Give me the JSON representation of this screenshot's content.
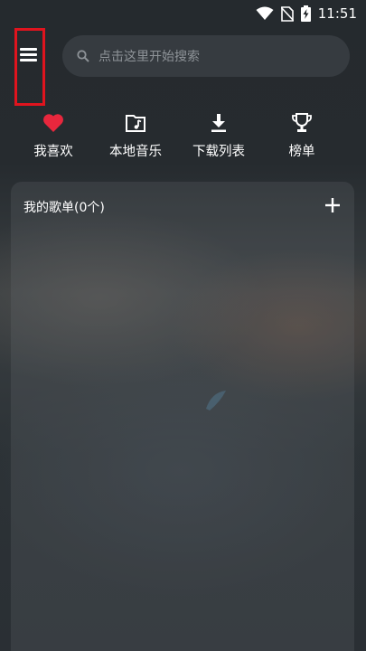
{
  "status_bar": {
    "time": "11:51",
    "icons": [
      "wifi-icon",
      "no-sim-icon",
      "battery-charging-icon"
    ]
  },
  "header": {
    "menu_icon": "menu-icon",
    "search": {
      "icon": "search-icon",
      "placeholder": "点击这里开始搜索"
    }
  },
  "quick_actions": [
    {
      "icon": "heart-icon",
      "label": "我喜欢",
      "color": "#e8273d"
    },
    {
      "icon": "music-folder-icon",
      "label": "本地音乐"
    },
    {
      "icon": "download-icon",
      "label": "下载列表"
    },
    {
      "icon": "trophy-icon",
      "label": "榜单"
    }
  ],
  "playlists": {
    "title": "我的歌单(0个)",
    "add_icon": "plus-icon"
  },
  "colors": {
    "accent": "#e8273d",
    "highlight_box": "#e0141e",
    "search_bg": "#363b40",
    "text_secondary": "#8e9398"
  }
}
